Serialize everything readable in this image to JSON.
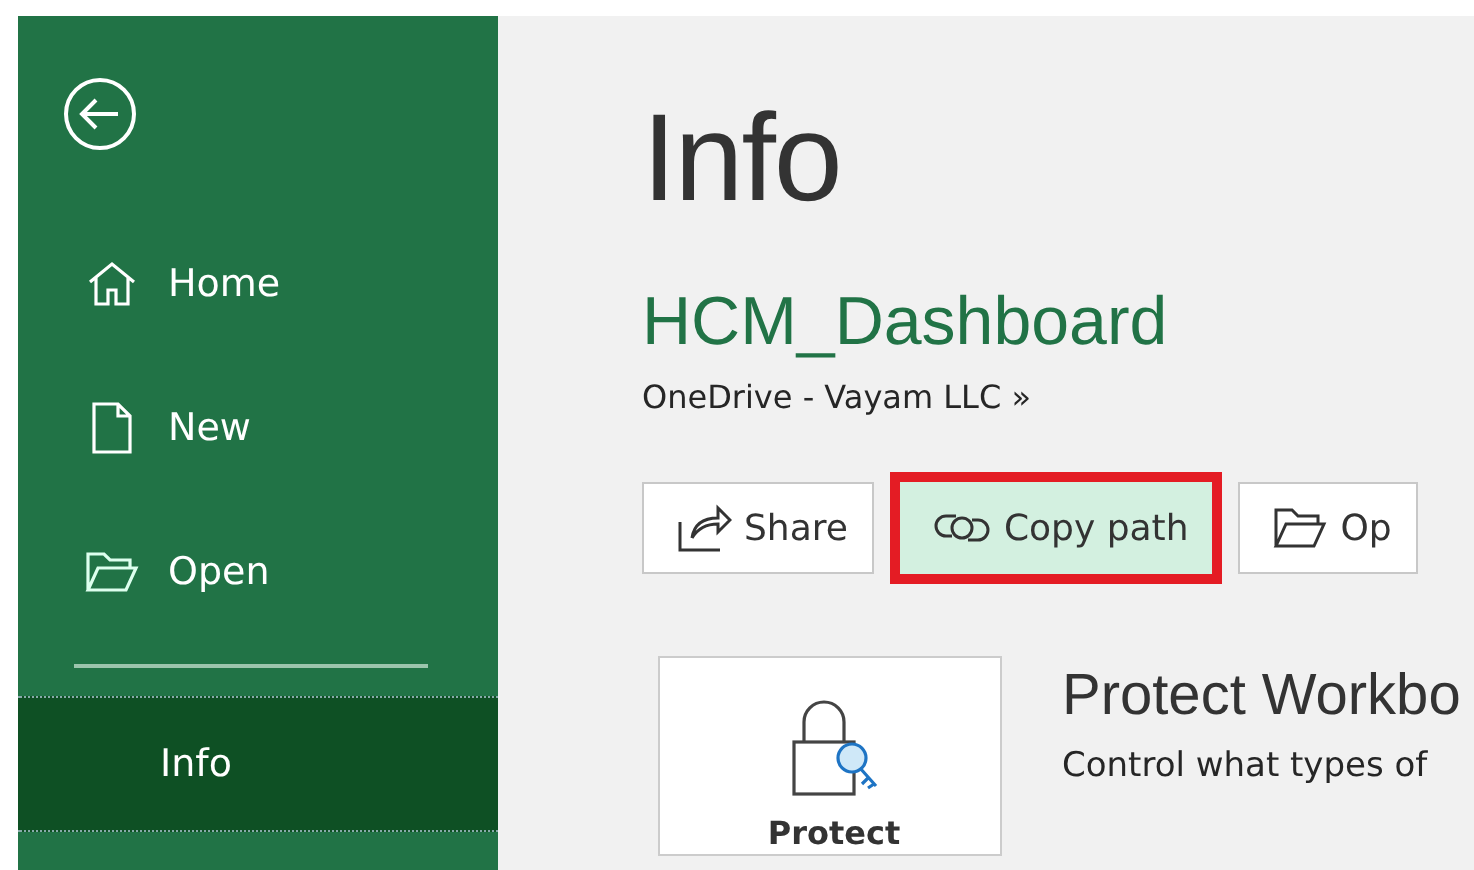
{
  "sidebar": {
    "items": [
      {
        "kind": "home",
        "label": "Home",
        "selected": false
      },
      {
        "kind": "new",
        "label": "New",
        "selected": false
      },
      {
        "kind": "open",
        "label": "Open",
        "selected": false
      },
      {
        "kind": "text",
        "label": "Info",
        "selected": true
      }
    ]
  },
  "page_title": "Info",
  "file": {
    "name": "HCM_Dashboard",
    "location": "OneDrive - Vayam LLC »"
  },
  "actions": [
    {
      "kind": "share",
      "label": "Share",
      "hovered": false,
      "outlined_red": false
    },
    {
      "kind": "link",
      "label": "Copy path",
      "hovered": true,
      "outlined_red": true
    },
    {
      "kind": "folder",
      "label": "Op",
      "hovered": false,
      "outlined_red": false
    }
  ],
  "protect": {
    "button_label": "Protect",
    "title": "Protect Workbo",
    "description": "Control what types of"
  }
}
